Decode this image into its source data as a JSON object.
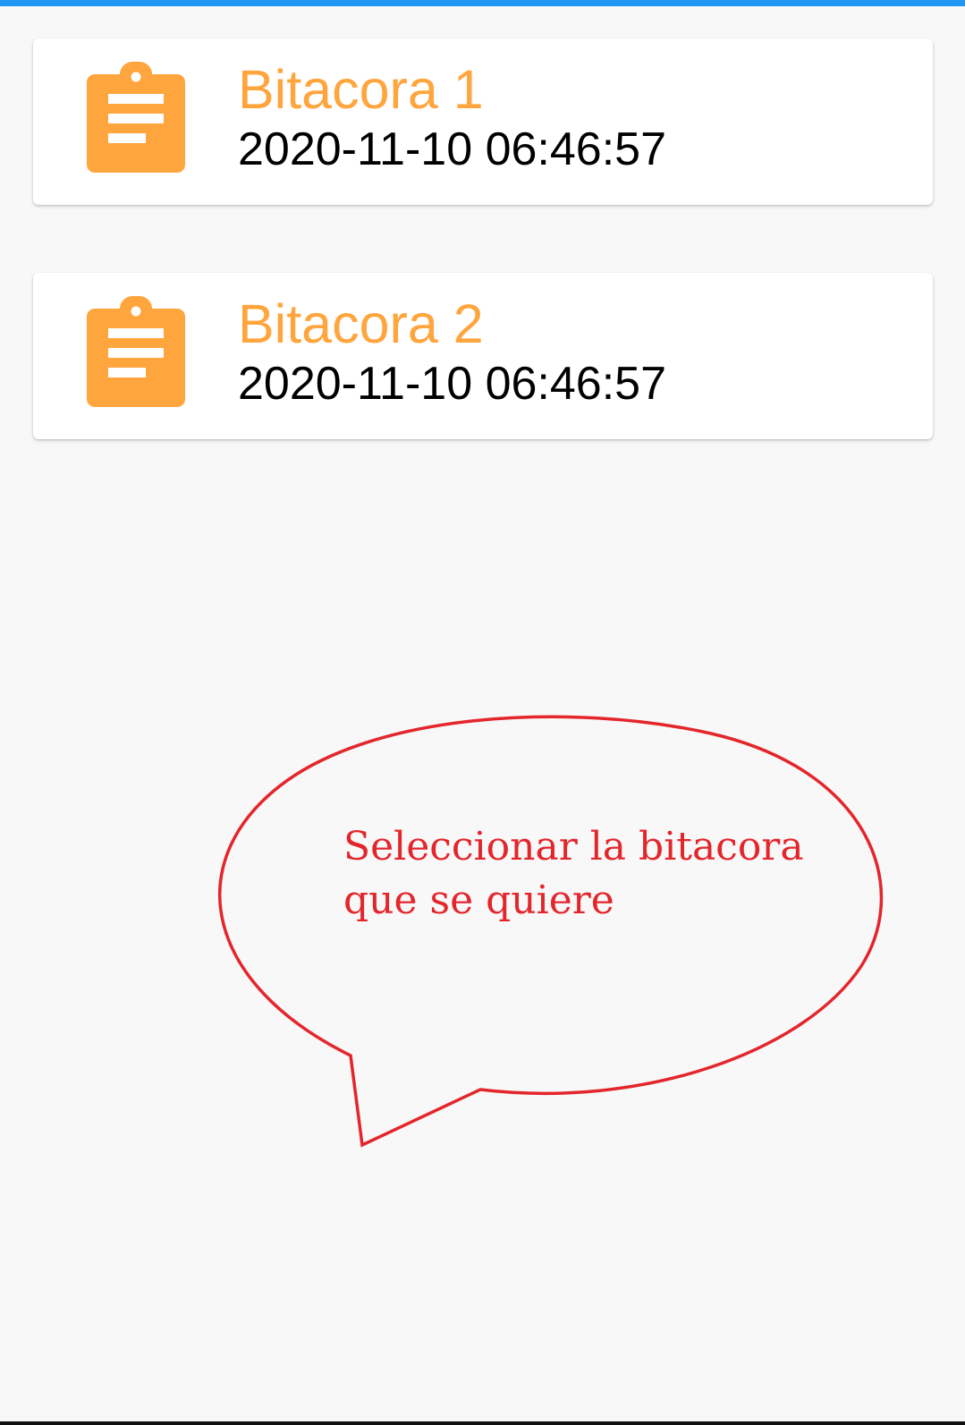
{
  "status_bar": {
    "color": "#2196f3"
  },
  "bitacoras": [
    {
      "title": "Bitacora 1",
      "date": "2020-11-10 06:46:57",
      "icon": "clipboard-icon"
    },
    {
      "title": "Bitacora 2",
      "date": "2020-11-10 06:46:57",
      "icon": "clipboard-icon"
    }
  ],
  "annotation": {
    "line1": "Seleccionar la bitacora",
    "line2": "que se quiere",
    "color": "#e3262c"
  },
  "colors": {
    "accent": "#ffa53d",
    "background": "#f8f8f8",
    "card": "#ffffff"
  }
}
